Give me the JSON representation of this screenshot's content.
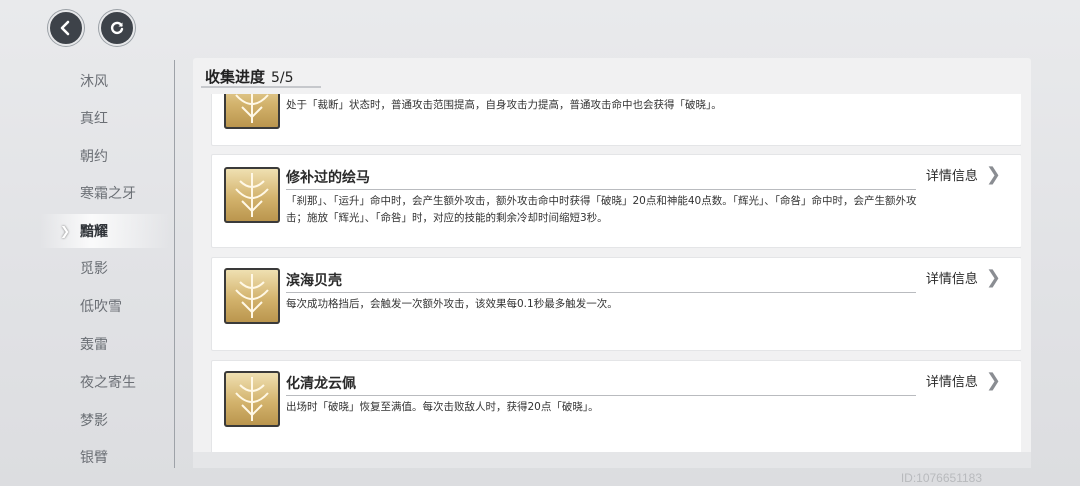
{
  "buttons": {
    "back_icon": "back-arrow",
    "refresh_icon": "refresh"
  },
  "sidebar": {
    "items": [
      {
        "label": "沐风",
        "active": false
      },
      {
        "label": "真红",
        "active": false
      },
      {
        "label": "朝约",
        "active": false
      },
      {
        "label": "寒霜之牙",
        "active": false
      },
      {
        "label": "黯耀",
        "active": true
      },
      {
        "label": "觅影",
        "active": false
      },
      {
        "label": "低吹雪",
        "active": false
      },
      {
        "label": "轰雷",
        "active": false
      },
      {
        "label": "夜之寄生",
        "active": false
      },
      {
        "label": "梦影",
        "active": false
      },
      {
        "label": "银臂",
        "active": false
      }
    ]
  },
  "panel": {
    "title": "收集进度",
    "count": "5/5"
  },
  "items": [
    {
      "name": "",
      "desc": "处于「裁断」状态时，普通攻击范围提高，自身攻击力提高，普通攻击命中也会获得「破晓」。",
      "detail_label": ""
    },
    {
      "name": "修补过的绘马",
      "desc": "「刹那」、「运升」命中时，会产生额外攻击，额外攻击命中时获得「破晓」20点和神能40点数。「辉光」、「命咎」命中时，会产生额外攻击；施放「辉光」、「命咎」时，对应的技能的剩余冷却时间缩短3秒。",
      "detail_label": "详情信息"
    },
    {
      "name": "滨海贝壳",
      "desc": "每次成功格挡后，会触发一次额外攻击，该效果每0.1秒最多触发一次。",
      "detail_label": "详情信息"
    },
    {
      "name": "化清龙云佩",
      "desc": "出场时「破晓」恢复至满值。每次击败敌人时，获得20点「破晓」。",
      "detail_label": "详情信息"
    }
  ],
  "footer": {
    "id_text": "ID:1076651183"
  }
}
